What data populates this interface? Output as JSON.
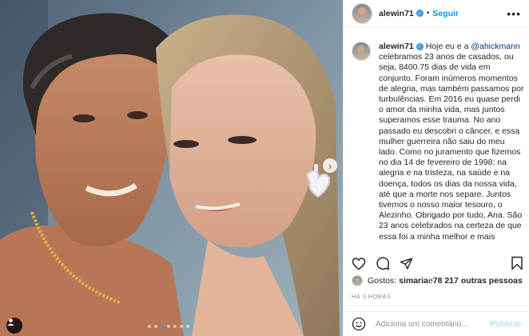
{
  "post": {
    "username": "alewin71",
    "follow_label": "Seguir",
    "separator": "•",
    "more_label": "•••",
    "caption": {
      "text_before": "Hoje eu e a ",
      "mention": "@ahickmann",
      "text_after": " celebramos 23 anos de casados, ou seja, 8400.75 dias de vida em conjunto. Foram inúmeros momentos de alegria, mas também passamos por turbulências. Em 2016 eu quase perdi o amor da minha vida, mas juntos superamos esse trauma. No ano passado eu descobri o câncer, e essa mulher guerreira não saiu do meu lado. Como no juramento que fizemos no dia 14 de fevereiro de 1998: na alegria e na tristeza, na saúde e na doença, todos os dias da nossa vida, até que a morte nos separe. Juntos tivemos o nosso maior tesouro, o Alezinho. Obrigado por tudo, Ana. São 23 anos celebrados na certeza de que essa foi a minha melhor e mais"
    },
    "likes": {
      "prefix": "Gostos: ",
      "user": "simaria",
      "middle": " e ",
      "count": "78 217 outras pessoas"
    },
    "time_ago": "HÁ 3 HORAS",
    "comment": {
      "placeholder": "Adiciona um comentário...",
      "publish_label": "Publicar"
    }
  },
  "carousel": {
    "slide_count": 7,
    "active_index": 2
  },
  "icons": {
    "next": "chevron-right-icon",
    "tag": "user-tag-icon",
    "like": "heart-icon",
    "comment": "comment-icon",
    "share": "paper-plane-icon",
    "save": "bookmark-icon",
    "emoji": "emoji-icon"
  },
  "colors": {
    "link": "#0095f6",
    "mention": "#00376b",
    "verified": "#3897f0",
    "muted": "#8e8e8e"
  }
}
